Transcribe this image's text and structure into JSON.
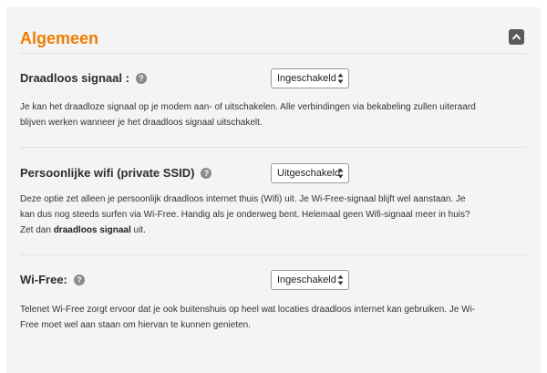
{
  "panel": {
    "title": "Algemeen",
    "collapse_icon": "chevron-up-icon"
  },
  "sections": [
    {
      "label": "Draadloos signaal :",
      "help_icon": "question-icon",
      "select_value": "Ingeschakeld",
      "description": "Je kan het draadloze signaal op je modem aan- of uitschakelen. Alle verbindingen via bekabeling zullen uiteraard blijven werken wanneer je het draadloos signaal uitschakelt."
    },
    {
      "label": "Persoonlijke wifi (private SSID)",
      "help_icon": "question-icon",
      "select_value": "Uitgeschakeld",
      "description_before": "Deze optie zet alleen je persoonlijk draadloos internet thuis (Wifi) uit. Je Wi-Free-signaal blijft wel aanstaan. Je kan dus nog steeds surfen via Wi-Free. Handig als je onderweg bent. Helemaal geen Wifi-signaal meer in huis? Zet dan ",
      "description_bold": "draadloos signaal",
      "description_after": " uit."
    },
    {
      "label": "Wi-Free:",
      "help_icon": "question-icon",
      "select_value": "Ingeschakeld",
      "description": "Telenet Wi-Free zorgt ervoor dat je ook buitenshuis op heel wat locaties draadloos internet kan gebruiken. Je Wi-Free moet wel aan staan om hiervan te kunnen genieten."
    }
  ],
  "colors": {
    "accent": "#f07c00",
    "panel_bg": "#f4f4f4",
    "divider": "#e1e1e1"
  }
}
